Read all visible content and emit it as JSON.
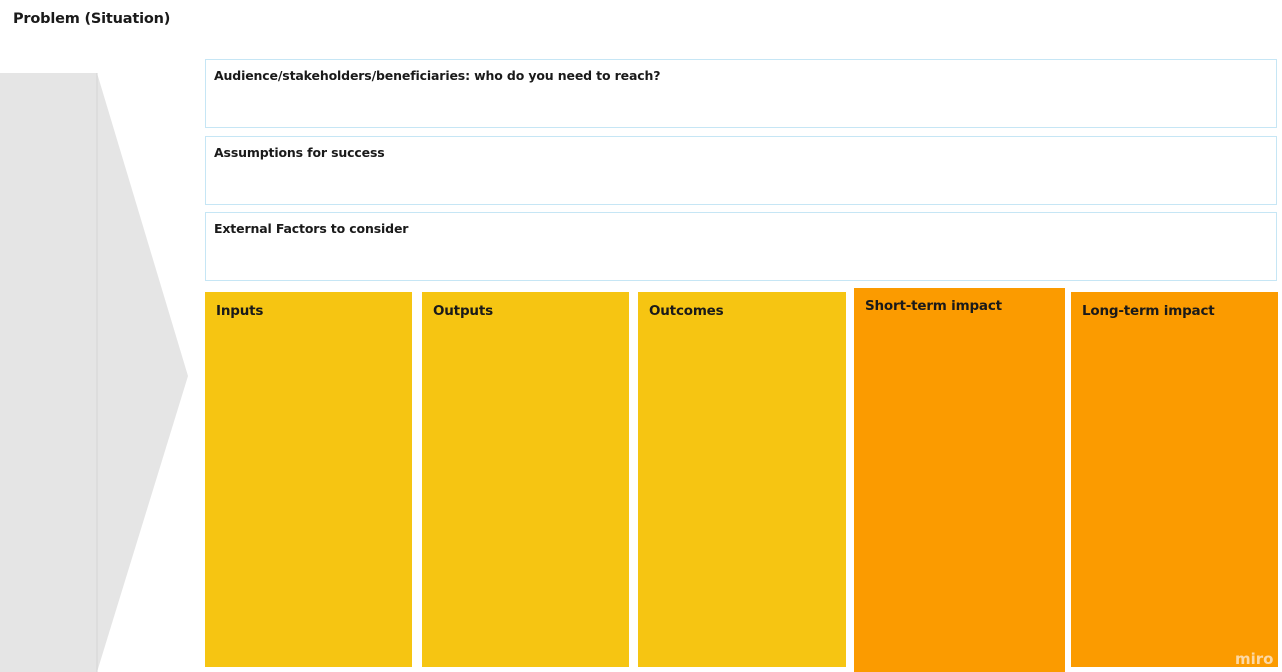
{
  "title": "Problem (Situation)",
  "colors": {
    "arrow": "#e5e5e5",
    "arrow_shade": "#d5d5d5",
    "info_border": "#c6e6f5",
    "stage_yellow": "#f6c512",
    "stage_orange": "#fb9b00"
  },
  "info_boxes": [
    {
      "label": "Audience/stakeholders/beneficiaries: who do you need to reach?"
    },
    {
      "label": "Assumptions for success"
    },
    {
      "label": "External Factors to consider"
    }
  ],
  "stages": [
    {
      "label": "Inputs",
      "color": "#f6c512"
    },
    {
      "label": "Outputs",
      "color": "#f6c512"
    },
    {
      "label": "Outcomes",
      "color": "#f6c512"
    },
    {
      "label": "Short-term impact",
      "color": "#fb9b00"
    },
    {
      "label": "Long-term impact",
      "color": "#fb9b00"
    }
  ],
  "watermark": "miro"
}
